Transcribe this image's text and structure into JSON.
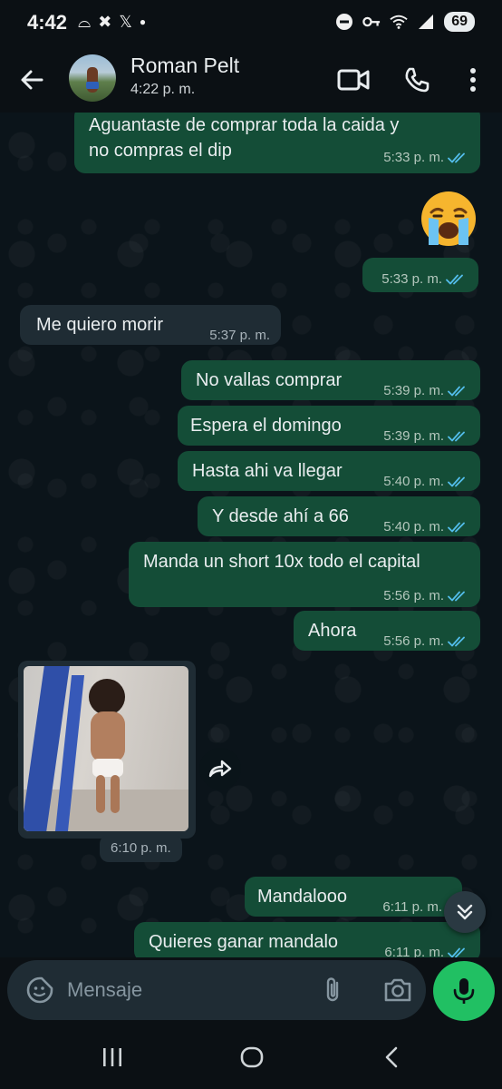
{
  "status_bar": {
    "time": "4:42",
    "left_icons": [
      "dnd-face-icon",
      "close-x-icon",
      "x-logo-icon",
      "dot-icon"
    ],
    "battery": "69"
  },
  "header": {
    "contact_name": "Roman Pelt",
    "last_seen": "4:22 p. m."
  },
  "messages": [
    {
      "dir": "out",
      "lines": [
        "Aguantaste de comprar toda la caida y",
        "no compras el dip"
      ],
      "time": "5:33 p. m."
    },
    {
      "dir": "out",
      "emoji": "crying-face",
      "time": "5:33 p. m."
    },
    {
      "dir": "in",
      "text": "Me quiero morir",
      "time": "5:37 p. m."
    },
    {
      "dir": "out",
      "text": "No vallas comprar",
      "time": "5:39 p. m."
    },
    {
      "dir": "out",
      "text": "Espera el domingo",
      "time": "5:39 p. m."
    },
    {
      "dir": "out",
      "text": "Hasta ahi va llegar",
      "time": "5:40 p. m."
    },
    {
      "dir": "out",
      "text": "Y desde ahí a 66",
      "time": "5:40 p. m."
    },
    {
      "dir": "out",
      "text": "Manda un short 10x todo el capital",
      "time": "5:56 p. m."
    },
    {
      "dir": "out",
      "text": "Ahora",
      "time": "5:56 p. m."
    },
    {
      "dir": "in",
      "image": "child-standing-photo",
      "time": "6:10 p. m."
    },
    {
      "dir": "out",
      "text": "Mandalooo",
      "time": "6:11 p. m."
    },
    {
      "dir": "out",
      "text": "Quieres ganar mandalo",
      "time": "6:11 p. m."
    }
  ],
  "composer": {
    "placeholder": "Mensaje"
  },
  "colors": {
    "outgoing_bubble": "#144d37",
    "incoming_bubble": "#1f2c34",
    "read_ticks": "#53bdeb",
    "mic_button": "#21c063"
  }
}
